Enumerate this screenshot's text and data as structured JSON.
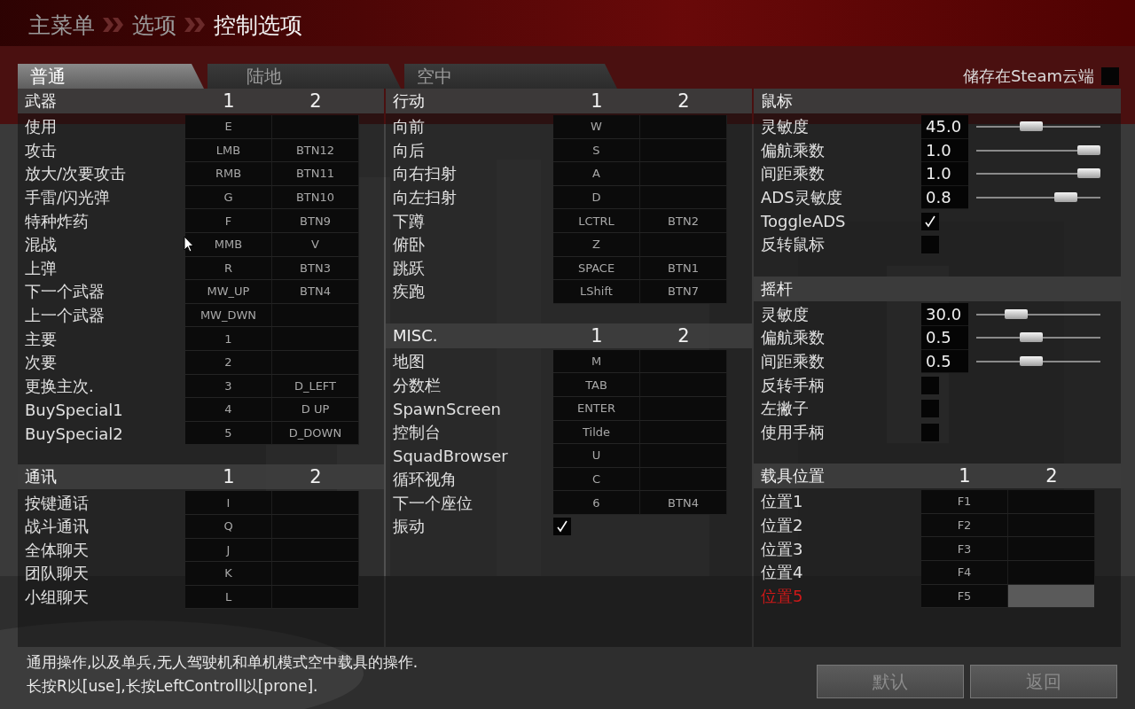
{
  "breadcrumb": [
    "主菜单",
    "选项",
    "控制选项"
  ],
  "tabs": [
    {
      "label": "普通",
      "selected": true
    },
    {
      "label": "陆地",
      "selected": false
    },
    {
      "label": "空中",
      "selected": false
    }
  ],
  "cloud_save": {
    "label": "储存在Steam云端",
    "checked": false
  },
  "columns": [
    {
      "sections": [
        {
          "title": "武器",
          "slot_headers": [
            "1",
            "2"
          ],
          "rows": [
            {
              "kind": "binding",
              "label": "使用",
              "key1": "E",
              "selected": false
            },
            {
              "kind": "binding",
              "label": "攻击",
              "key1": "LMB",
              "key2": "BTN12",
              "selected": false
            },
            {
              "kind": "binding",
              "label": "放大/次要攻击",
              "key1": "RMB",
              "key2": "BTN11",
              "selected": false
            },
            {
              "kind": "binding",
              "label": "手雷/闪光弹",
              "key1": "G",
              "key2": "BTN10",
              "selected": false
            },
            {
              "kind": "binding",
              "label": "特种炸药",
              "key1": "F",
              "key2": "BTN9",
              "selected": false
            },
            {
              "kind": "binding",
              "label": "混战",
              "key1": "MMB",
              "key2": "V",
              "selected": false
            },
            {
              "kind": "binding",
              "label": "上弹",
              "key1": "R",
              "key2": "BTN3",
              "selected": false
            },
            {
              "kind": "binding",
              "label": "下一个武器",
              "key1": "MW_UP",
              "key2": "BTN4",
              "selected": false
            },
            {
              "kind": "binding",
              "label": "上一个武器",
              "key1": "MW_DWN",
              "selected": false
            },
            {
              "kind": "binding",
              "label": "主要",
              "key1": "1",
              "selected": false
            },
            {
              "kind": "binding",
              "label": "次要",
              "key1": "2",
              "selected": false
            },
            {
              "kind": "binding",
              "label": "更换主次.",
              "key1": "3",
              "key2": "D_LEFT",
              "selected": false
            },
            {
              "kind": "binding",
              "label": "BuySpecial1",
              "key1": "4",
              "key2": "D UP",
              "selected": false
            },
            {
              "kind": "binding",
              "label": "BuySpecial2",
              "key1": "5",
              "key2": "D_DOWN",
              "selected": false
            }
          ]
        },
        {
          "title": "通讯",
          "slot_headers": [
            "1",
            "2"
          ],
          "rows": [
            {
              "kind": "binding",
              "label": "按键通话",
              "key1": "I",
              "selected": false
            },
            {
              "kind": "binding",
              "label": "战斗通讯",
              "key1": "Q",
              "selected": false
            },
            {
              "kind": "binding",
              "label": "全体聊天",
              "key1": "J",
              "selected": false
            },
            {
              "kind": "binding",
              "label": "团队聊天",
              "key1": "K",
              "selected": false
            },
            {
              "kind": "binding",
              "label": "小组聊天",
              "key1": "L",
              "selected": false
            }
          ]
        }
      ]
    },
    {
      "sections": [
        {
          "title": "行动",
          "slot_headers": [
            "1",
            "2"
          ],
          "rows": [
            {
              "kind": "binding",
              "label": "向前",
              "key1": "W",
              "selected": false
            },
            {
              "kind": "binding",
              "label": "向后",
              "key1": "S",
              "selected": false
            },
            {
              "kind": "binding",
              "label": "向右扫射",
              "key1": "A",
              "selected": false
            },
            {
              "kind": "binding",
              "label": "向左扫射",
              "key1": "D",
              "selected": false
            },
            {
              "kind": "binding",
              "label": "下蹲",
              "key1": "LCTRL",
              "key2": "BTN2",
              "selected": false
            },
            {
              "kind": "binding",
              "label": "俯卧",
              "key1": "Z",
              "selected": false
            },
            {
              "kind": "binding",
              "label": "跳跃",
              "key1": "SPACE",
              "key2": "BTN1",
              "selected": false
            },
            {
              "kind": "binding",
              "label": "疾跑",
              "key1": "LShift",
              "key2": "BTN7",
              "selected": false
            }
          ]
        },
        {
          "title": "MISC.",
          "slot_headers": [
            "1",
            "2"
          ],
          "rows": [
            {
              "kind": "binding",
              "label": "地图",
              "key1": "M",
              "selected": false
            },
            {
              "kind": "binding",
              "label": "分数栏",
              "key1": "TAB",
              "selected": false
            },
            {
              "kind": "binding",
              "label": "SpawnScreen",
              "key1": "ENTER",
              "selected": false
            },
            {
              "kind": "binding",
              "label": "控制台",
              "key1": "Tilde",
              "selected": false
            },
            {
              "kind": "binding",
              "label": "SquadBrowser",
              "key1": "U",
              "selected": false
            },
            {
              "kind": "binding",
              "label": "循环视角",
              "key1": "C",
              "selected": false
            },
            {
              "kind": "binding",
              "label": "下一个座位",
              "key1": "6",
              "key2": "BTN4",
              "selected": false
            },
            {
              "kind": "checkbox",
              "label": "振动",
              "checked": true
            }
          ]
        }
      ]
    },
    {
      "sections": [
        {
          "title": "鼠标",
          "rows": [
            {
              "kind": "slider",
              "label": "灵敏度",
              "reading": "45.0",
              "level": 0.43
            },
            {
              "kind": "slider",
              "label": "偏航乘数",
              "reading": "1.0",
              "level": 1
            },
            {
              "kind": "slider",
              "label": "间距乘数",
              "reading": "1.0",
              "level": 1
            },
            {
              "kind": "slider",
              "label": "ADS灵敏度",
              "reading": "0.8",
              "level": 0.77
            },
            {
              "kind": "checkbox",
              "label": "ToggleADS",
              "checked": true
            },
            {
              "kind": "checkbox",
              "label": "反转鼠标",
              "checked": false
            }
          ]
        },
        {
          "title": "摇杆",
          "rows": [
            {
              "kind": "slider",
              "label": "灵敏度",
              "reading": "30.0",
              "level": 0.28
            },
            {
              "kind": "slider",
              "label": "偏航乘数",
              "reading": "0.5",
              "level": 0.43
            },
            {
              "kind": "slider",
              "label": "间距乘数",
              "reading": "0.5",
              "level": 0.43
            },
            {
              "kind": "checkbox",
              "label": "反转手柄",
              "checked": false
            },
            {
              "kind": "checkbox",
              "label": "左撇子",
              "checked": false
            },
            {
              "kind": "checkbox",
              "label": "使用手柄",
              "checked": false
            }
          ]
        },
        {
          "title": "载具位置",
          "slot_headers": [
            "1",
            "2"
          ],
          "rows": [
            {
              "kind": "binding",
              "label": "位置1",
              "key1": "F1",
              "selected": false
            },
            {
              "kind": "binding",
              "label": "位置2",
              "key1": "F2",
              "selected": false
            },
            {
              "kind": "binding",
              "label": "位置3",
              "key1": "F3",
              "selected": false
            },
            {
              "kind": "binding",
              "label": "位置4",
              "key1": "F4",
              "selected": false
            },
            {
              "kind": "binding",
              "label": "位置5",
              "key1": "F5",
              "selected": true
            }
          ]
        }
      ]
    }
  ],
  "help_lines": [
    "通用操作,以及单兵,无人驾驶机和单机模式空中载具的操作.",
    "长按R以[use],长按LeftControll以[prone]."
  ],
  "buttons": [
    "默认",
    "返回"
  ]
}
